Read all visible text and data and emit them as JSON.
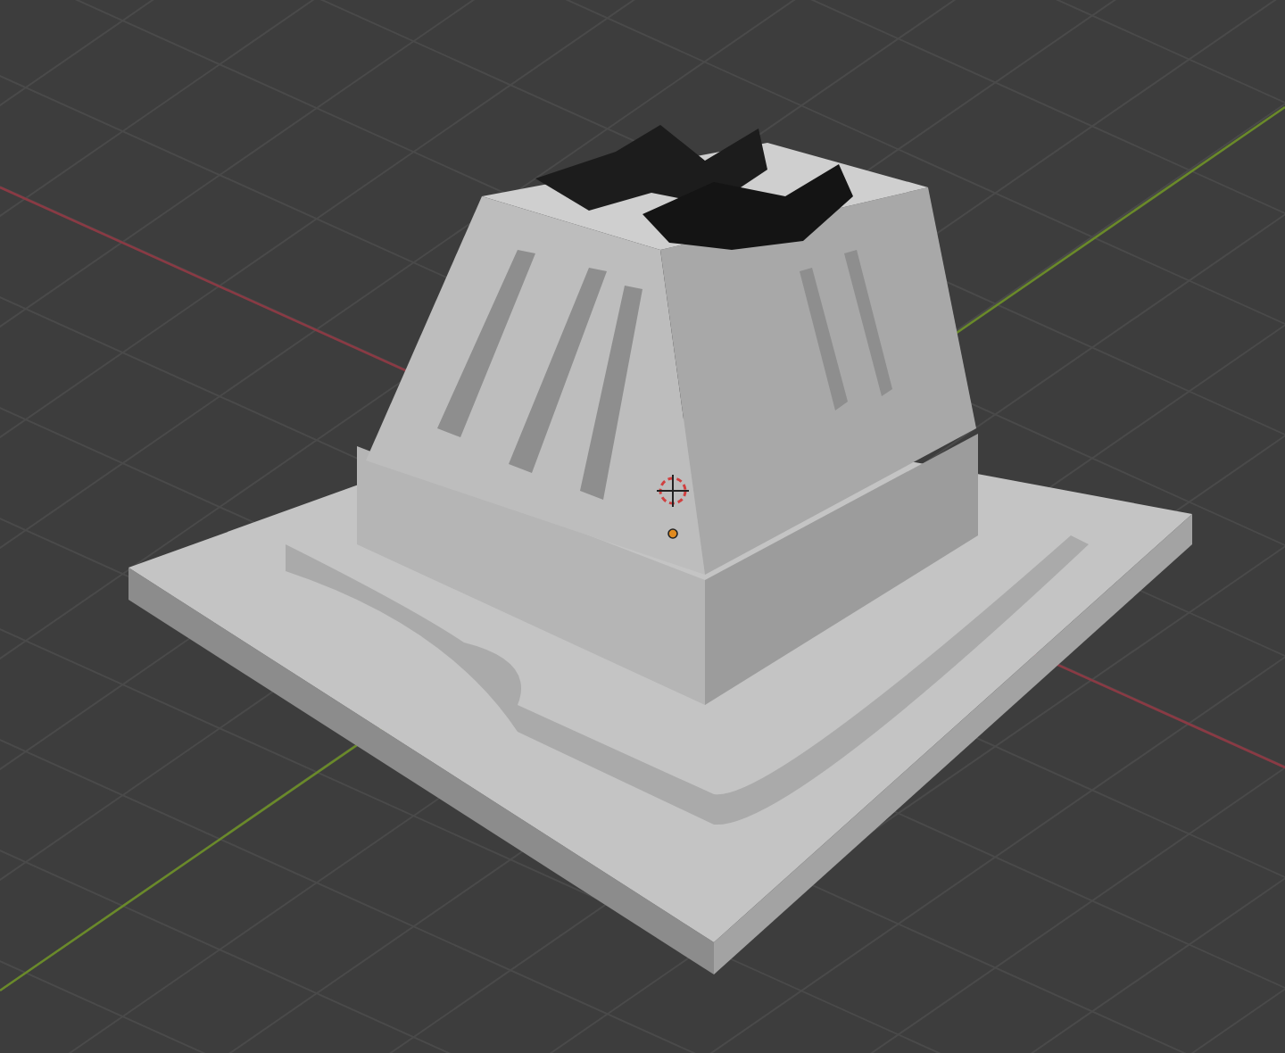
{
  "viewport": {
    "show_grid": true,
    "show_axes": true,
    "show_cursor": true,
    "show_origin": true
  }
}
